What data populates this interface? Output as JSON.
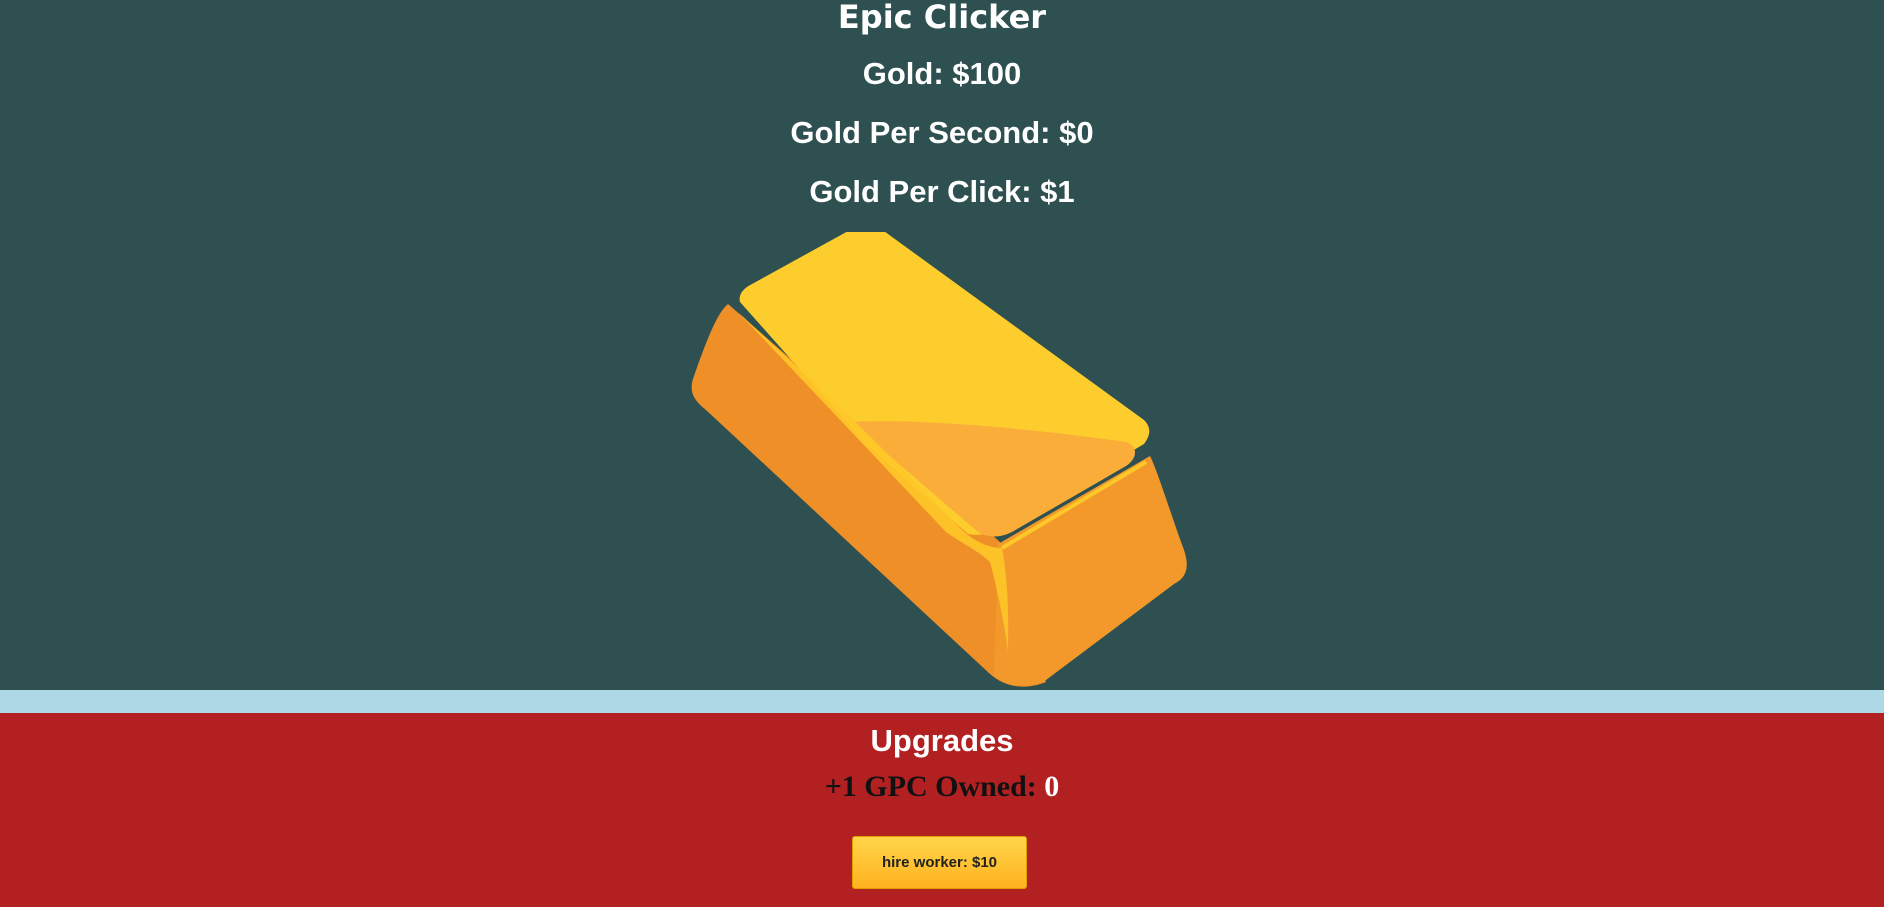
{
  "game": {
    "title": "Epic Clicker",
    "gold_text": "Gold: $100",
    "gold_per_second_text": "Gold Per Second: $0",
    "gold_per_click_text": "Gold Per Click: $1",
    "clicker_icon": "gold-bar-icon"
  },
  "upgrades": {
    "title": "Upgrades",
    "owned_label": "+1 GPC Owned: ",
    "owned_count": "0",
    "hire_button_label": "hire worker: $10"
  },
  "colors": {
    "game_background": "#2f5050",
    "divider": "#add8e6",
    "upgrades_background": "#b22022",
    "button_gold": "#ffc62e"
  }
}
